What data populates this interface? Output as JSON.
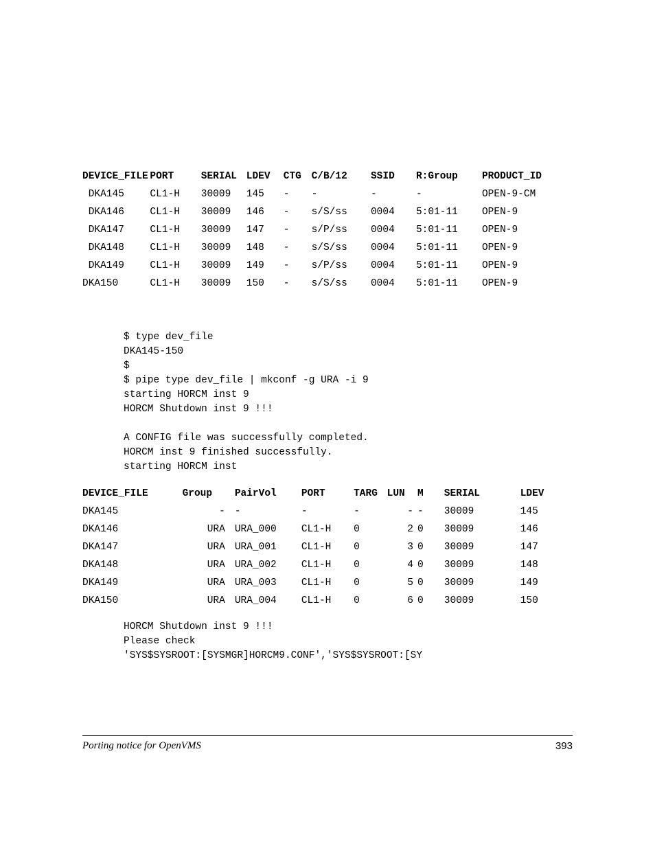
{
  "table1": {
    "headers": {
      "c0": "DEVICE_FILE",
      "c1": "PORT",
      "c2": "SERIAL",
      "c3": "LDEV",
      "c4": "CTG",
      "c5": "C/B/12",
      "c6": "SSID",
      "c7": "R:Group",
      "c8": "PRODUCT_ID"
    },
    "rows": [
      {
        "c0": "DKA145",
        "c1": "CL1-H",
        "c2": "30009",
        "c3": "145",
        "c4": "-",
        "c5": "-",
        "c6": "-",
        "c7": "-",
        "c8": "OPEN-9-CM"
      },
      {
        "c0": "DKA146",
        "c1": "CL1-H",
        "c2": "30009",
        "c3": "146",
        "c4": "-",
        "c5": "s/S/ss",
        "c6": "0004",
        "c7": "5:01-11",
        "c8": "OPEN-9"
      },
      {
        "c0": "DKA147",
        "c1": "CL1-H",
        "c2": "30009",
        "c3": "147",
        "c4": "-",
        "c5": "s/P/ss",
        "c6": "0004",
        "c7": "5:01-11",
        "c8": "OPEN-9"
      },
      {
        "c0": "DKA148",
        "c1": "CL1-H",
        "c2": "30009",
        "c3": "148",
        "c4": "-",
        "c5": "s/S/ss",
        "c6": "0004",
        "c7": "5:01-11",
        "c8": "OPEN-9"
      },
      {
        "c0": "DKA149",
        "c1": "CL1-H",
        "c2": "30009",
        "c3": "149",
        "c4": "-",
        "c5": "s/P/ss",
        "c6": "0004",
        "c7": "5:01-11",
        "c8": "OPEN-9"
      },
      {
        "c0": "DKA150",
        "c1": "CL1-H",
        "c2": "30009",
        "c3": "150",
        "c4": "-",
        "c5": "s/S/ss",
        "c6": "0004",
        "c7": "5:01-11",
        "c8": "OPEN-9"
      }
    ]
  },
  "block1": "$ type dev_file\nDKA145-150\n$\n$ pipe type dev_file | mkconf -g URA -i 9\nstarting HORCM inst 9\nHORCM Shutdown inst 9 !!!\n\nA CONFIG file was successfully completed.\nHORCM inst 9 finished successfully.\nstarting HORCM inst",
  "table2": {
    "headers": {
      "c0": "DEVICE_FILE",
      "c1": "Group",
      "c2": "PairVol",
      "c3": "PORT",
      "c4": "TARG",
      "c5": "LUN",
      "c6": "M",
      "c7": "SERIAL",
      "c8": "LDEV"
    },
    "rows": [
      {
        "c0": "DKA145",
        "c1": "-",
        "c2": "-",
        "c3": "-",
        "c4": "-",
        "c5": "-",
        "c6": "-",
        "c7": "30009",
        "c8": "145"
      },
      {
        "c0": "DKA146",
        "c1": "URA",
        "c2": "URA_000",
        "c3": "CL1-H",
        "c4": "0",
        "c5": "2",
        "c6": "0",
        "c7": "30009",
        "c8": "146"
      },
      {
        "c0": "DKA147",
        "c1": "URA",
        "c2": "URA_001",
        "c3": "CL1-H",
        "c4": "0",
        "c5": "3",
        "c6": "0",
        "c7": "30009",
        "c8": "147"
      },
      {
        "c0": "DKA148",
        "c1": "URA",
        "c2": "URA_002",
        "c3": "CL1-H",
        "c4": "0",
        "c5": "4",
        "c6": "0",
        "c7": "30009",
        "c8": "148"
      },
      {
        "c0": "DKA149",
        "c1": "URA",
        "c2": "URA_003",
        "c3": "CL1-H",
        "c4": "0",
        "c5": "5",
        "c6": "0",
        "c7": "30009",
        "c8": "149"
      },
      {
        "c0": "DKA150",
        "c1": "URA",
        "c2": "URA_004",
        "c3": "CL1-H",
        "c4": "0",
        "c5": "6",
        "c6": "0",
        "c7": "30009",
        "c8": "150"
      }
    ]
  },
  "block2": "HORCM Shutdown inst 9 !!!\nPlease check\n'SYS$SYSROOT:[SYSMGR]HORCM9.CONF','SYS$SYSROOT:[SY",
  "footer": {
    "left": "Porting notice for OpenVMS",
    "right": "393"
  }
}
